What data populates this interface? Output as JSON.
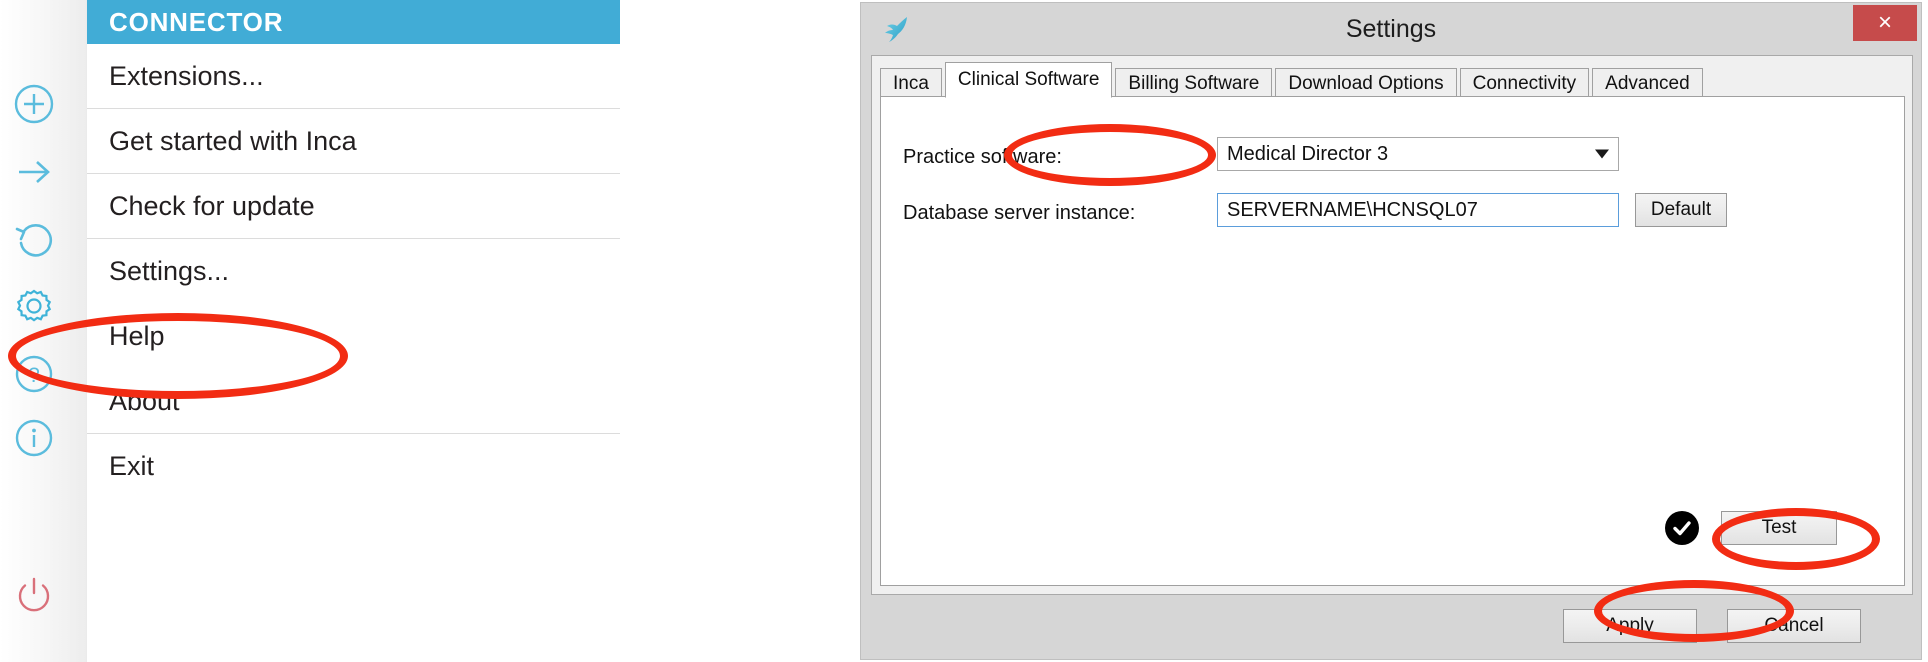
{
  "connector_menu": {
    "title": "CONNECTOR",
    "accent_color": "#41acd6",
    "items": [
      {
        "label": "Extensions...",
        "icon": "plus-circle-icon"
      },
      {
        "label": "Get started with Inca",
        "icon": "arrow-right-icon"
      },
      {
        "label": "Check for update",
        "icon": "refresh-icon"
      },
      {
        "label": "Settings...",
        "icon": "gear-icon"
      },
      {
        "label": "Help",
        "icon": "question-circle-icon"
      },
      {
        "label": "About",
        "icon": "info-circle-icon"
      },
      {
        "label": "Exit",
        "icon": "power-icon"
      }
    ]
  },
  "settings_dialog": {
    "title": "Settings",
    "app_icon": "kookaburra-bird-icon",
    "close_label": "×",
    "close_color": "#c64b4b",
    "tabs": [
      {
        "label": "Inca",
        "active": false
      },
      {
        "label": "Clinical Software",
        "active": true
      },
      {
        "label": "Billing Software",
        "active": false
      },
      {
        "label": "Download Options",
        "active": false
      },
      {
        "label": "Connectivity",
        "active": false
      },
      {
        "label": "Advanced",
        "active": false
      }
    ],
    "fields": {
      "practice_software": {
        "label": "Practice software:",
        "value": "Medical Director 3",
        "control": "combobox"
      },
      "database_server_instance": {
        "label": "Database server instance:",
        "value": "SERVERNAME\\HCNSQL07",
        "placeholder": "",
        "control": "textbox"
      }
    },
    "buttons": {
      "default": "Default",
      "test": "Test",
      "apply": "Apply",
      "cancel": "Cancel"
    },
    "status": {
      "test_result_icon": "check-circle-icon",
      "test_result_color": "#000000"
    }
  },
  "annotations": {
    "color": "#f22c13",
    "ellipses": [
      {
        "name": "highlight-settings-menu-item"
      },
      {
        "name": "highlight-database-server-instance-field"
      },
      {
        "name": "highlight-test-button"
      },
      {
        "name": "highlight-apply-button"
      }
    ]
  }
}
